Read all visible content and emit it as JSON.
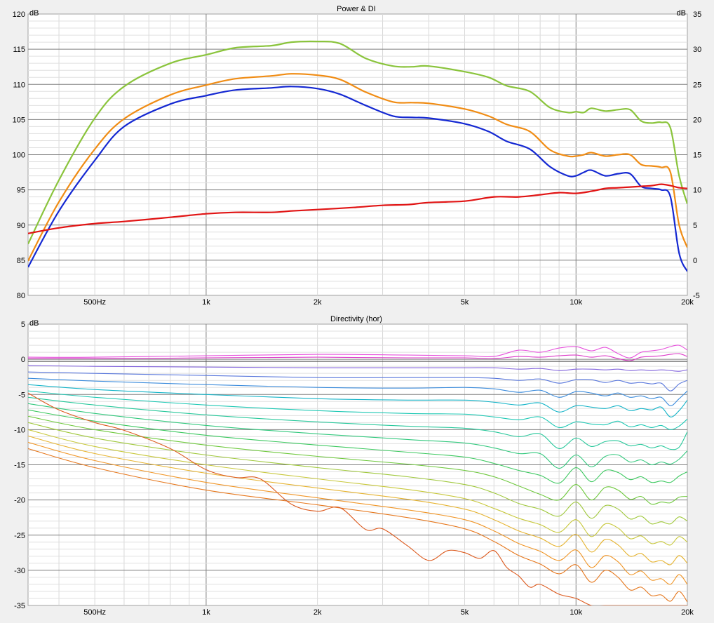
{
  "chart_data": [
    {
      "type": "line",
      "title": "Power & DI",
      "ylabel": "dB",
      "ylabel_right": "dB",
      "xscale": "log",
      "xlim": [
        330,
        20000
      ],
      "ylim": [
        80,
        120
      ],
      "ylim_right": [
        -5,
        35
      ],
      "grid": true,
      "x_ticks": [
        {
          "v": 500,
          "label": "500Hz"
        },
        {
          "v": 1000,
          "label": "1k"
        },
        {
          "v": 2000,
          "label": "2k"
        },
        {
          "v": 5000,
          "label": "5k"
        },
        {
          "v": 10000,
          "label": "10k"
        },
        {
          "v": 20000,
          "label": "20k"
        }
      ],
      "y_ticks": [
        "80",
        "85",
        "90",
        "95",
        "100",
        "105",
        "110",
        "115",
        "120"
      ],
      "y_ticks_right": [
        "-5",
        "0",
        "5",
        "10",
        "15",
        "20",
        "25",
        "30",
        "35"
      ],
      "series": [
        {
          "color": "#8ac43c",
          "x": [
            330,
            400,
            500,
            600,
            800,
            1000,
            1200,
            1500,
            1700,
            2000,
            2300,
            2700,
            3200,
            3600,
            4000,
            5000,
            5800,
            6500,
            7500,
            8500,
            9500,
            10000,
            10500,
            11000,
            12000,
            13000,
            14000,
            15000,
            16000,
            17000,
            18000,
            19000,
            20000
          ],
          "y": [
            87.3,
            96.4,
            105.2,
            109.7,
            113.0,
            114.2,
            115.2,
            115.5,
            116.0,
            116.1,
            115.8,
            113.7,
            112.6,
            112.5,
            112.6,
            111.8,
            111.0,
            109.8,
            109.0,
            106.7,
            106.0,
            106.1,
            106.0,
            106.6,
            106.2,
            106.4,
            106.4,
            104.8,
            104.5,
            104.6,
            103.8,
            97.0,
            93.0
          ]
        },
        {
          "color": "#f08c14",
          "x": [
            330,
            400,
            500,
            600,
            800,
            1000,
            1200,
            1500,
            1700,
            2000,
            2300,
            2700,
            3200,
            3600,
            4000,
            5000,
            5800,
            6500,
            7500,
            8500,
            9500,
            10000,
            10500,
            11000,
            12000,
            13000,
            14000,
            15000,
            16000,
            17000,
            18000,
            19000,
            20000
          ],
          "y": [
            84.9,
            93.3,
            100.8,
            105.1,
            108.5,
            109.9,
            110.8,
            111.2,
            111.5,
            111.3,
            110.7,
            108.9,
            107.5,
            107.4,
            107.3,
            106.5,
            105.5,
            104.3,
            103.3,
            100.7,
            99.8,
            99.8,
            100.0,
            100.3,
            99.8,
            100.0,
            100.0,
            98.6,
            98.4,
            98.2,
            97.5,
            90.0,
            86.8
          ]
        },
        {
          "color": "#1428d2",
          "x": [
            330,
            400,
            500,
            600,
            800,
            1000,
            1200,
            1500,
            1700,
            2000,
            2300,
            2700,
            3200,
            3600,
            4000,
            5000,
            5800,
            6500,
            7500,
            8500,
            9500,
            10000,
            10500,
            11000,
            12000,
            13000,
            14000,
            15000,
            16000,
            17000,
            18000,
            19000,
            20000
          ],
          "y": [
            84.0,
            92.0,
            99.2,
            104.0,
            107.2,
            108.4,
            109.2,
            109.5,
            109.7,
            109.4,
            108.6,
            107.0,
            105.5,
            105.3,
            105.2,
            104.4,
            103.3,
            101.9,
            100.8,
            98.3,
            97.0,
            97.0,
            97.5,
            97.8,
            97.0,
            97.3,
            97.3,
            95.5,
            95.2,
            95.0,
            94.0,
            86.0,
            83.4
          ]
        },
        {
          "color": "#e11414",
          "axis": "right",
          "x": [
            330,
            400,
            500,
            600,
            800,
            1000,
            1200,
            1500,
            1700,
            2000,
            2500,
            3000,
            3500,
            4000,
            5000,
            6000,
            7000,
            8000,
            9000,
            10000,
            11000,
            12000,
            13000,
            14000,
            15000,
            16000,
            17000,
            18000,
            19000,
            20000
          ],
          "y": [
            3.8,
            4.6,
            5.2,
            5.5,
            6.1,
            6.6,
            6.8,
            6.8,
            7.0,
            7.2,
            7.5,
            7.8,
            7.9,
            8.2,
            8.4,
            9.0,
            9.0,
            9.3,
            9.6,
            9.5,
            9.8,
            10.2,
            10.3,
            10.4,
            10.5,
            10.6,
            10.8,
            10.6,
            10.3,
            10.2
          ]
        }
      ]
    },
    {
      "type": "line",
      "title": "Directivity (hor)",
      "ylabel": "dB",
      "xscale": "log",
      "xlim": [
        330,
        20000
      ],
      "ylim": [
        -35,
        5
      ],
      "grid": true,
      "x_ticks": [
        {
          "v": 500,
          "label": "500Hz"
        },
        {
          "v": 1000,
          "label": "1k"
        },
        {
          "v": 2000,
          "label": "2k"
        },
        {
          "v": 5000,
          "label": "5k"
        },
        {
          "v": 10000,
          "label": "10k"
        },
        {
          "v": 20000,
          "label": "20k"
        }
      ],
      "y_ticks": [
        "-35",
        "-30",
        "-25",
        "-20",
        "-15",
        "-10",
        "-5",
        "0",
        "5"
      ],
      "x_shared": [
        330,
        500,
        1000,
        2000,
        3500,
        5000,
        6000,
        7000,
        8000,
        9000,
        10000,
        11000,
        12000,
        13000,
        14000,
        15000,
        16000,
        17000,
        18000,
        19000,
        20000
      ],
      "series": [
        {
          "color": "#e650dc",
          "y": [
            0.3,
            0.3,
            0.5,
            0.7,
            0.6,
            0.5,
            0.4,
            1.3,
            1.0,
            1.6,
            1.8,
            1.2,
            1.7,
            0.8,
            0.2,
            1.0,
            1.2,
            1.4,
            1.8,
            2.0,
            1.3
          ]
        },
        {
          "color": "#dc3cc8",
          "y": [
            0.1,
            0.1,
            0.2,
            0.3,
            0.2,
            0.2,
            0.1,
            0.4,
            0.3,
            0.5,
            0.6,
            0.3,
            0.5,
            0.1,
            -0.2,
            0.3,
            0.4,
            0.5,
            0.7,
            0.8,
            0.4
          ]
        },
        {
          "color": "#505050",
          "y": [
            -0.3,
            -0.3,
            -0.3,
            -0.3,
            -0.3,
            -0.3,
            -0.3,
            -0.3,
            -0.3,
            -0.3,
            -0.3,
            -0.3,
            -0.3,
            -0.3,
            -0.3,
            -0.3,
            -0.3,
            -0.3,
            -0.3,
            -0.3,
            -0.3
          ]
        },
        {
          "color": "#8264dc",
          "y": [
            -0.9,
            -1.0,
            -1.1,
            -1.2,
            -1.2,
            -1.2,
            -1.2,
            -1.4,
            -1.3,
            -1.6,
            -1.4,
            -1.4,
            -1.5,
            -1.4,
            -1.6,
            -1.5,
            -1.6,
            -1.5,
            -1.6,
            -1.7,
            -1.5
          ]
        },
        {
          "color": "#5a78dc",
          "y": [
            -1.8,
            -2.0,
            -2.3,
            -2.6,
            -2.6,
            -2.6,
            -2.7,
            -3.0,
            -2.8,
            -3.4,
            -2.9,
            -2.9,
            -3.3,
            -3.0,
            -3.4,
            -3.3,
            -3.5,
            -3.4,
            -4.5,
            -3.5,
            -3.0
          ]
        },
        {
          "color": "#3c8cdc",
          "y": [
            -2.7,
            -3.1,
            -3.6,
            -4.0,
            -4.1,
            -4.0,
            -4.2,
            -4.7,
            -4.4,
            -5.4,
            -4.6,
            -4.8,
            -5.2,
            -4.8,
            -5.4,
            -5.2,
            -5.6,
            -5.4,
            -6.6,
            -5.6,
            -4.5
          ]
        },
        {
          "color": "#14b4c8",
          "y": [
            -3.6,
            -4.3,
            -5.0,
            -5.6,
            -5.8,
            -5.8,
            -6.1,
            -6.5,
            -6.2,
            -7.5,
            -6.6,
            -6.8,
            -7.0,
            -6.6,
            -7.3,
            -7.0,
            -7.2,
            -6.8,
            -8.2,
            -7.3,
            -5.8
          ]
        },
        {
          "color": "#1ec8b4",
          "y": [
            -4.5,
            -5.4,
            -6.5,
            -7.3,
            -7.7,
            -7.8,
            -8.2,
            -8.6,
            -8.2,
            -9.7,
            -8.9,
            -9.2,
            -9.3,
            -8.8,
            -9.6,
            -9.3,
            -9.7,
            -9.4,
            -10.0,
            -9.5,
            -8.5
          ]
        },
        {
          "color": "#28c89b",
          "y": [
            -5.4,
            -6.5,
            -7.9,
            -8.9,
            -9.5,
            -9.8,
            -10.3,
            -11.0,
            -10.6,
            -12.7,
            -11.2,
            -12.4,
            -11.7,
            -11.6,
            -12.3,
            -12.1,
            -12.6,
            -12.3,
            -12.8,
            -12.5,
            -10.3
          ]
        },
        {
          "color": "#32c87d",
          "y": [
            -6.3,
            -7.7,
            -9.4,
            -10.6,
            -11.4,
            -11.9,
            -12.6,
            -13.4,
            -13.4,
            -15.5,
            -13.6,
            -15.3,
            -13.8,
            -13.6,
            -14.6,
            -14.3,
            -15.0,
            -14.6,
            -14.9,
            -14.2,
            -13.0
          ]
        },
        {
          "color": "#3cc85f",
          "y": [
            -7.2,
            -8.8,
            -10.8,
            -12.2,
            -13.2,
            -13.9,
            -14.8,
            -15.8,
            -16.5,
            -17.6,
            -15.4,
            -17.4,
            -15.8,
            -16.1,
            -17.1,
            -16.7,
            -17.5,
            -17.3,
            -17.5,
            -16.6,
            -16.0
          ]
        },
        {
          "color": "#6ec83c",
          "y": [
            -8.1,
            -10.0,
            -12.2,
            -13.8,
            -14.9,
            -15.8,
            -16.7,
            -18.0,
            -19.2,
            -20.0,
            -17.8,
            -20.0,
            -18.2,
            -18.6,
            -19.9,
            -19.5,
            -20.6,
            -20.3,
            -20.4,
            -19.6,
            -19.5
          ]
        },
        {
          "color": "#a0c83c",
          "y": [
            -9.0,
            -11.2,
            -13.6,
            -15.4,
            -16.7,
            -17.8,
            -19.0,
            -20.5,
            -21.3,
            -22.3,
            -20.3,
            -22.6,
            -20.8,
            -21.3,
            -22.7,
            -22.3,
            -23.4,
            -23.1,
            -23.4,
            -22.4,
            -23.0
          ]
        },
        {
          "color": "#c8c83c",
          "y": [
            -10.0,
            -12.4,
            -15.0,
            -17.0,
            -18.5,
            -19.8,
            -21.2,
            -22.6,
            -23.5,
            -24.6,
            -22.8,
            -25.2,
            -23.4,
            -24.0,
            -25.5,
            -25.1,
            -26.2,
            -25.9,
            -26.4,
            -25.2,
            -26.0
          ]
        },
        {
          "color": "#e6b432",
          "y": [
            -10.9,
            -13.4,
            -16.2,
            -18.3,
            -19.9,
            -21.3,
            -22.8,
            -24.4,
            -25.4,
            -26.6,
            -24.9,
            -27.4,
            -25.6,
            -26.4,
            -28.0,
            -27.6,
            -28.8,
            -28.6,
            -29.2,
            -27.9,
            -29.0
          ]
        },
        {
          "color": "#f09628",
          "y": [
            -11.8,
            -14.4,
            -17.5,
            -19.7,
            -21.4,
            -22.8,
            -24.4,
            -26.2,
            -27.3,
            -28.6,
            -27.1,
            -29.6,
            -27.9,
            -28.8,
            -30.6,
            -30.1,
            -31.4,
            -31.2,
            -32.0,
            -30.6,
            -32.0
          ]
        },
        {
          "color": "#e6781e",
          "y": [
            -12.7,
            -15.4,
            -18.6,
            -20.7,
            -22.5,
            -24.1,
            -25.9,
            -27.9,
            -29.1,
            -30.5,
            -29.2,
            -31.7,
            -30.0,
            -31.0,
            -32.8,
            -32.4,
            -33.6,
            -33.5,
            -34.4,
            -33.0,
            -34.5
          ]
        },
        {
          "color": "#dc5a1e",
          "y": [
            -4.8,
            -7.2,
            -9.0,
            -10.1,
            -12.7,
            -15.7,
            -16.8,
            -17.0,
            -20.6,
            -21.6,
            -21.1,
            -24.2,
            -24.1,
            -26.5,
            -28.6,
            -27.2,
            -27.5,
            -28.3,
            -27.2,
            -29.6,
            -30.8,
            -32.4,
            -32.0,
            -33.4,
            -34.0,
            -35.0,
            -35.0,
            -35.0,
            -35.0,
            -35.0,
            -35.0
          ]
        }
      ]
    }
  ]
}
